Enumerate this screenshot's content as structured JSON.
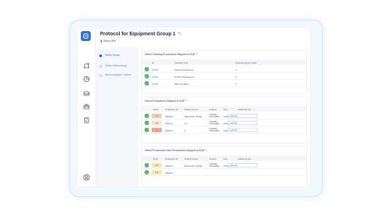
{
  "header": {
    "title": "Protocol for Equipment Group 1",
    "edit_glyph": "✎",
    "subtitle": "Bang Bull"
  },
  "steps": [
    {
      "label": "Define Scope",
      "state": "active"
    },
    {
      "label": "Define Methodology",
      "state": "pending"
    },
    {
      "label": "Set Acceptance Criteria",
      "state": "pending"
    }
  ],
  "section1": {
    "question": "Select Cleaning Procedures Mapped to EQP ?",
    "headers": [
      "ID",
      "Cleaning Type",
      "Cleaning Agents Used"
    ],
    "rows": [
      {
        "id": "CP001",
        "type": "Product Changeover",
        "agents": "4"
      },
      {
        "id": "CP002",
        "type": "Product Changeover",
        "agents": "2"
      },
      {
        "id": "CP003",
        "type": "Batch To Batch",
        "agents": "1"
      }
    ]
  },
  "section2": {
    "question": "Select Productions Mapped to EQP ?",
    "headers": [
      "Rank",
      "Production ID",
      "Product Name",
      "Criteria",
      "SAL",
      "Additional Info"
    ],
    "rows": [
      {
        "rank": "1,2",
        "rank_color": "#f6c9b5",
        "pid": "2D1212",
        "name": "Ibdiunamon 16 Mg",
        "criteria": "Solubility, Cleanability",
        "sal": "0,003",
        "info": "example"
      },
      {
        "rank": "1,2",
        "rank_color": "#fde3c2",
        "pid": "2D1212",
        "name": "1,2",
        "criteria": "Solubility, Cleanability",
        "sal": "0,003",
        "info": "example"
      },
      {
        "rank": "1",
        "rank_color": "#f4a48c",
        "pid": "2D1212",
        "name": "1",
        "criteria": "Solubility, Cleanability",
        "sal": "0,003",
        "info": "example"
      }
    ]
  },
  "section3": {
    "question": "Select Provisional Case Productions Mapped to EQP ?",
    "headers": [
      "Rank",
      "Production ID",
      "Product Name",
      "Criteria",
      "SAL",
      "Additional Info"
    ],
    "rows": [
      {
        "rank": "2,3",
        "rank_color": "#fbe6a6",
        "pid": "2D1212",
        "name": "Ibdiunamon 16 Mg",
        "criteria": "Solubility, Cleanability",
        "sal": "0,003",
        "info": "example"
      },
      {
        "rank": "2,3",
        "rank_color": "#fbe6a6",
        "pid": "2D1212",
        "name": "",
        "criteria": "",
        "sal": "",
        "info": ""
      }
    ]
  },
  "colors": {
    "accent": "#2f6fd6",
    "check": "#3aa655"
  }
}
